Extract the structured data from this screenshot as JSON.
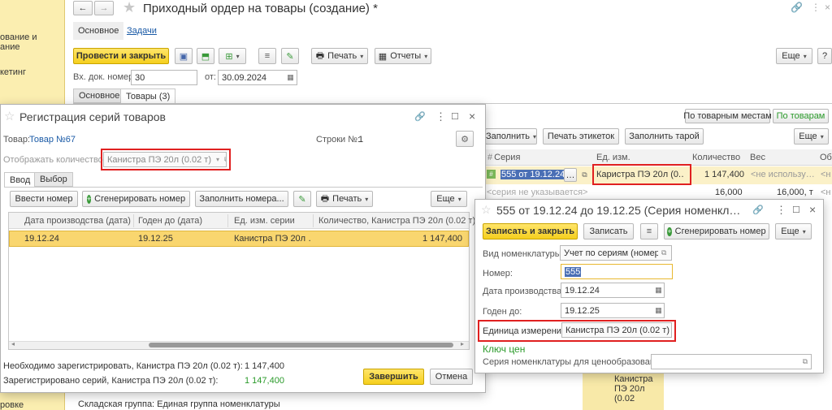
{
  "left_sidebar": {
    "items": [
      "ование и",
      "ание",
      "кетинг",
      "ровке"
    ]
  },
  "main_doc": {
    "title": "Приходный ордер на товары (создание) *",
    "tabs_top": [
      "Основное",
      "Задачи"
    ],
    "post_close_label": "Провести и закрыть",
    "print_label": "Печать",
    "reports_label": "Отчеты",
    "more_label": "Еще",
    "in_doc_number_label": "Вх. док. номер:",
    "in_doc_number_value": "30",
    "from_label": "от:",
    "from_value": "30.09.2024",
    "sub_tabs": [
      "Основное",
      "Товары (3)"
    ],
    "by_places_label": "По товарным местам",
    "by_goods_label": "По товарам",
    "fill_label": "Заполнить",
    "print_labels_label": "Печать этикеток",
    "fill_package_label": "Заполнить тарой",
    "more2_label": "Еще",
    "grid_headers": [
      "Серия",
      "Ед. изм.",
      "Количество",
      "Вес",
      "Об"
    ],
    "row1": {
      "series": "555 от 19.12.24",
      "unit": "Каристра ПЭ 20л (0.…",
      "qty": "1 147,400",
      "weight": "<не использу…",
      "extra": "<н"
    },
    "row2": {
      "series": "<серия не указывается>",
      "qty": "16,000",
      "weight": "16,000, т",
      "extra": "<н"
    },
    "bottom_text": "Складская группа: Единая группа номенклатуры",
    "bottom_right_item": "Канистра ПЭ 20л (0.02"
  },
  "series_dialog": {
    "title": "Регистрация серий товаров",
    "product_label": "Товар:",
    "product_value": "Товар №67",
    "rows_label": "Строки №:",
    "rows_value": "1",
    "show_qty_label": "Отображать количество в:",
    "show_qty_value": "Канистра ПЭ 20л (0.02 т)",
    "tabs": [
      "Ввод",
      "Выбор"
    ],
    "enter_number_label": "Ввести номер",
    "generate_label": "Сгенерировать номер",
    "fill_numbers_label": "Заполнить номера...",
    "print_label": "Печать",
    "more_label": "Еще",
    "columns": [
      "Дата производства (дата)",
      "Годен до (дата)",
      "Ед. изм. серии",
      "Количество, Канистра ПЭ 20л (0.02 т)"
    ],
    "rows": [
      {
        "prod_date": "19.12.24",
        "valid_to": "19.12.25",
        "unit": "Канистра ПЭ 20л …",
        "qty": "1 147,400"
      }
    ],
    "need_register_label": "Необходимо зарегистрировать, Канистра ПЭ 20л (0.02 т):",
    "need_register_value": "1 147,400",
    "registered_label": "Зарегистрировано серий, Канистра ПЭ 20л (0.02 т):",
    "registered_value": "1 147,400",
    "finish_label": "Завершить",
    "cancel_label": "Отмена"
  },
  "nom_series": {
    "title": "555 от 19.12.24 до 19.12.25 (Серия номенкл…",
    "save_close_label": "Записать и закрыть",
    "save_label": "Записать",
    "generate_label": "Сгенерировать номер",
    "more_label": "Еще",
    "kind_label": "Вид номенклатуры:",
    "kind_value": "Учет по сериям (номер, д",
    "number_label": "Номер:",
    "number_value": "555",
    "prod_date_label": "Дата производства:",
    "prod_date_value": "19.12.24",
    "valid_to_label": "Годен до:",
    "valid_to_value": "19.12.25",
    "unit_label": "Единица измерения:",
    "unit_value": "Канистра ПЭ 20л (0.02 т)",
    "price_key_title": "Ключ цен",
    "price_series_label": "Серия номенклатуры для ценообразования:",
    "price_series_value": ""
  },
  "colors": {
    "accent_yellow": "#f5cf1e",
    "selected_row": "#f9d66f",
    "green_text": "#2a9a2a",
    "red_box": "#e02020",
    "link": "#1a5aa6"
  }
}
